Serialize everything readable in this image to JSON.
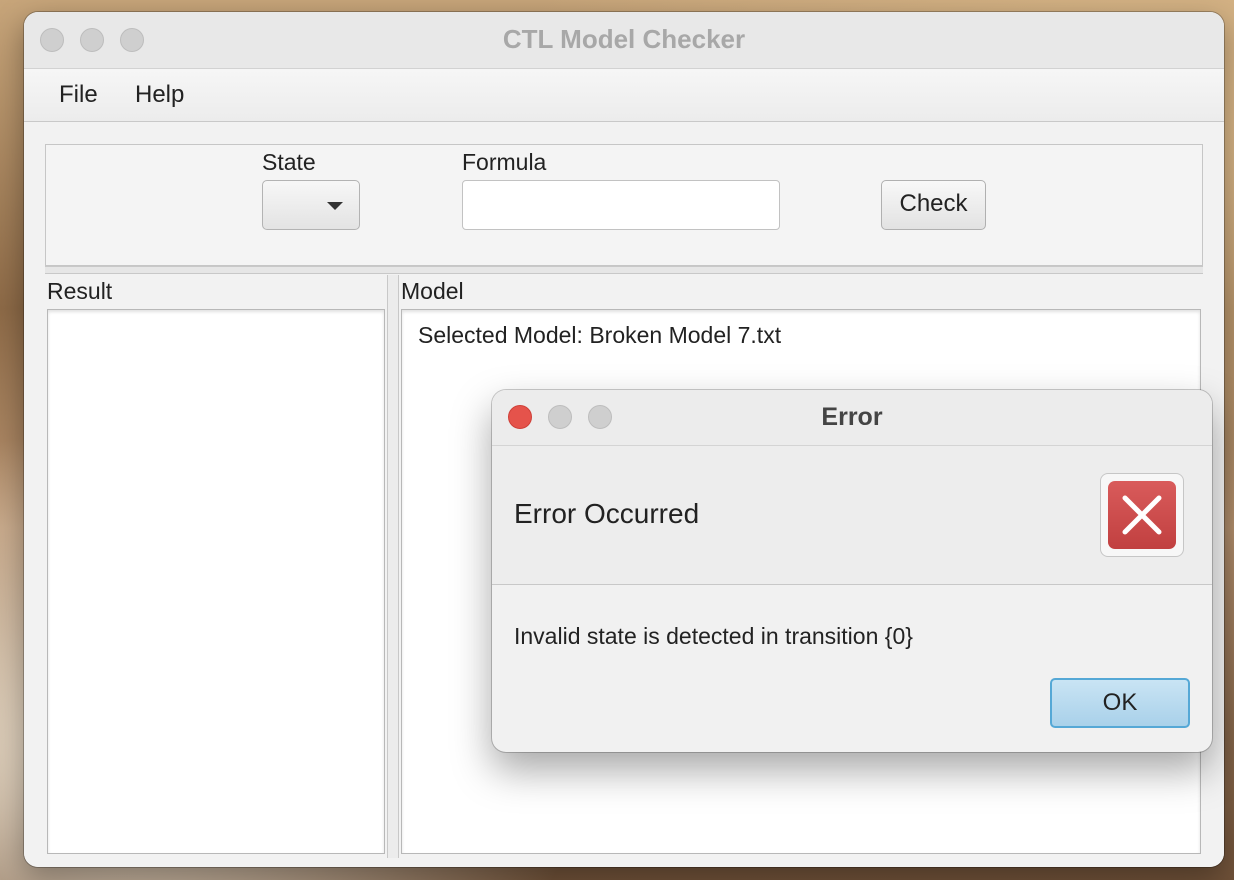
{
  "window": {
    "title": "CTL Model Checker"
  },
  "menubar": {
    "items": [
      {
        "label": "File"
      },
      {
        "label": "Help"
      }
    ]
  },
  "controls": {
    "state_label": "State",
    "state_value": "",
    "formula_label": "Formula",
    "formula_value": "",
    "check_label": "Check"
  },
  "panes": {
    "result": {
      "title": "Result",
      "content": ""
    },
    "model": {
      "title": "Model",
      "content": "Selected Model: Broken Model 7.txt"
    }
  },
  "dialog": {
    "title": "Error",
    "heading": "Error Occurred",
    "message": "Invalid state is detected in transition {0}",
    "ok_label": "OK",
    "icon": "error-x-icon",
    "colors": {
      "icon_bg": "#c94848",
      "close_light": "#e5534b",
      "ok_bg": "#b6dbf0"
    }
  }
}
